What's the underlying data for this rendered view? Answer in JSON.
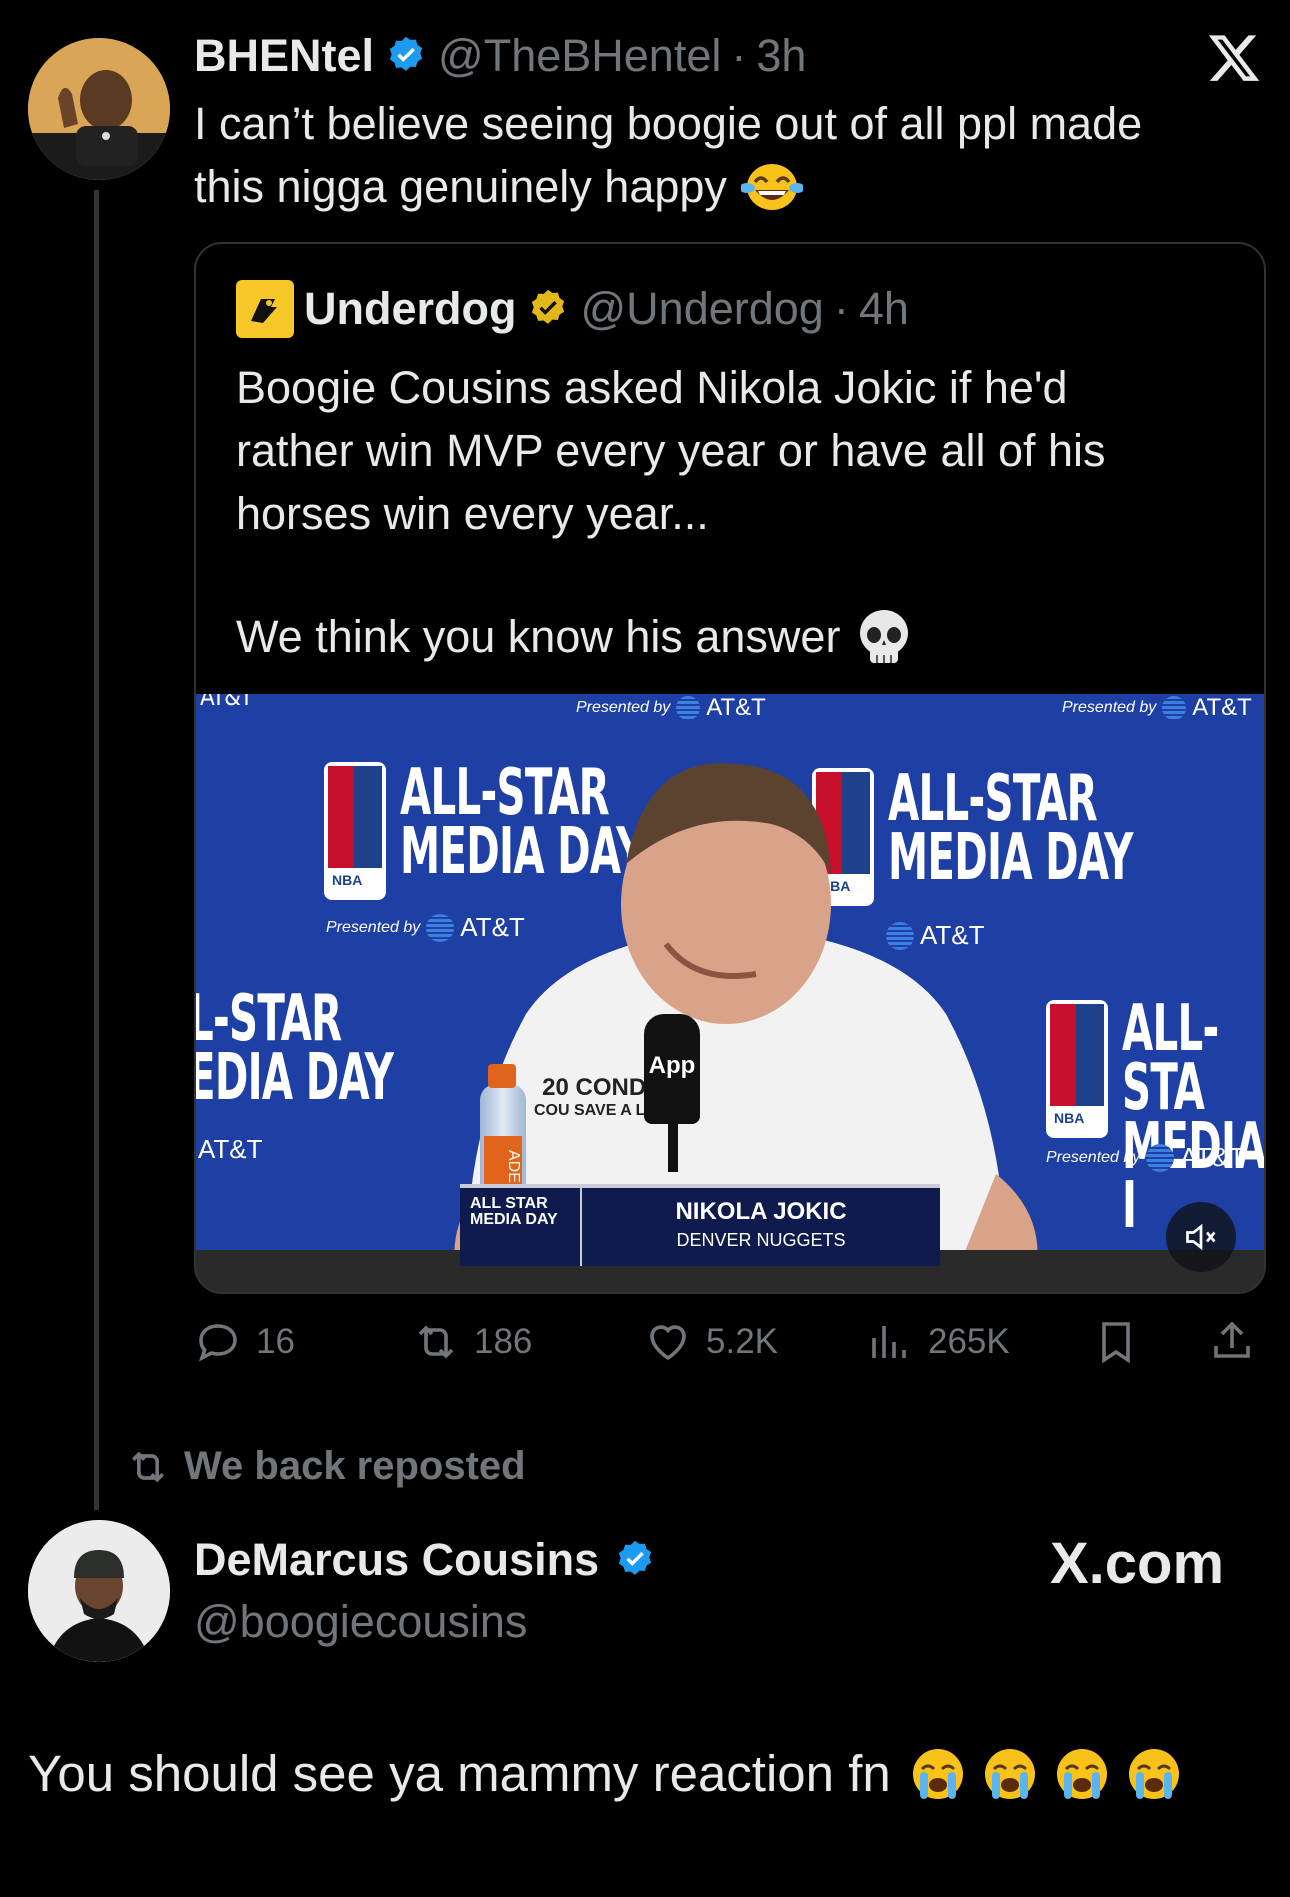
{
  "colors": {
    "background": "#000000",
    "text": "#e7e9ea",
    "muted": "#71767b",
    "verified_blue": "#1d9bf0",
    "verified_gold": "#e2b719",
    "video_blue": "#1e3fa3"
  },
  "main_tweet": {
    "display_name": "BHENtel",
    "handle": "@TheBHentel",
    "separator": "·",
    "time": "3h",
    "text_line1": "I can’t believe seeing boogie out of all ppl made",
    "text_line2": "this nigga genuinely happy",
    "emoji": "face-with-tears-of-joy"
  },
  "x_logo": "X",
  "quoted_tweet": {
    "display_name": "Underdog",
    "handle": "@Underdog",
    "separator": "·",
    "time": "4h",
    "text_line1": "Boogie Cousins asked Nikola Jokic if he'd",
    "text_line2": "rather win MVP every year or have all of his",
    "text_line3": "horses win every year...",
    "text_line4": "We think you know his answer",
    "emoji": "skull"
  },
  "video": {
    "banner_top_left": "AT&T",
    "presented_by": "Presented by",
    "sponsor": "AT&T",
    "event_line1": "ALL-STAR",
    "event_line2": "MEDIA DAY",
    "event_left_line1": "L-STAR",
    "event_left_line2": "EDIA DAY",
    "event_right_line1": "ALL-STA",
    "event_right_line2": "MEDIA I",
    "nba": "NBA",
    "mic_label": "App",
    "shirt_text1": "20  CONDS",
    "shirt_text2": "COU  SAVE A LIFE",
    "bottle_label": "ADE",
    "nameplate_event1": "ALL STAR",
    "nameplate_event2": "MEDIA DAY",
    "nameplate_name": "NIKOLA JOKIC",
    "nameplate_team": "DENVER NUGGETS",
    "mute_icon": "speaker-muted-icon"
  },
  "actions": {
    "replies": "16",
    "reposts": "186",
    "likes": "5.2K",
    "views": "265K"
  },
  "repost_bar": {
    "text": "We back reposted"
  },
  "second_tweet": {
    "display_name": "DeMarcus Cousins",
    "handle": "@boogiecousins",
    "watermark": "X.com",
    "text": "You should see ya mammy reaction fn",
    "emoji": "loudly-crying-face",
    "emoji_count": "4"
  }
}
